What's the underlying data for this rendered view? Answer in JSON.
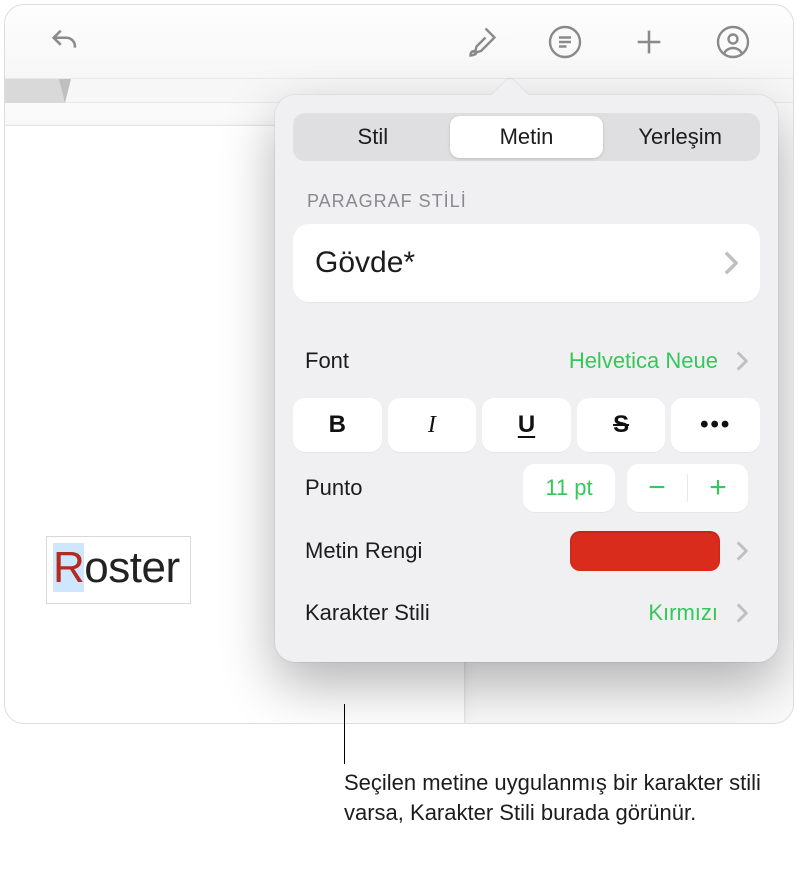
{
  "toolbar": {
    "back_icon": "undo",
    "format_icon": "paintbrush",
    "threads_icon": "list",
    "plus_icon": "plus",
    "collab_icon": "collaborate"
  },
  "document": {
    "selected_text": "R",
    "rest_text": "oster"
  },
  "popover": {
    "tabs": {
      "stil": "Stil",
      "metin": "Metin",
      "yerlesim": "Yerleşim"
    },
    "paragraf_header": "PARAGRAF STİLİ",
    "paragraph_style": "Gövde*",
    "font_label": "Font",
    "font_value": "Helvetica Neue",
    "bold": "B",
    "italic": "I",
    "underline": "U",
    "strike": "S",
    "more": "•••",
    "punto_label": "Punto",
    "punto_value": "11 pt",
    "minus": "−",
    "plus": "+",
    "color_label": "Metin Rengi",
    "color_value": "#d92c1c",
    "charstyle_label": "Karakter Stili",
    "charstyle_value": "Kırmızı"
  },
  "callout": "Seçilen metine uygulanmış bir karakter stili varsa, Karakter Stili burada görünür."
}
